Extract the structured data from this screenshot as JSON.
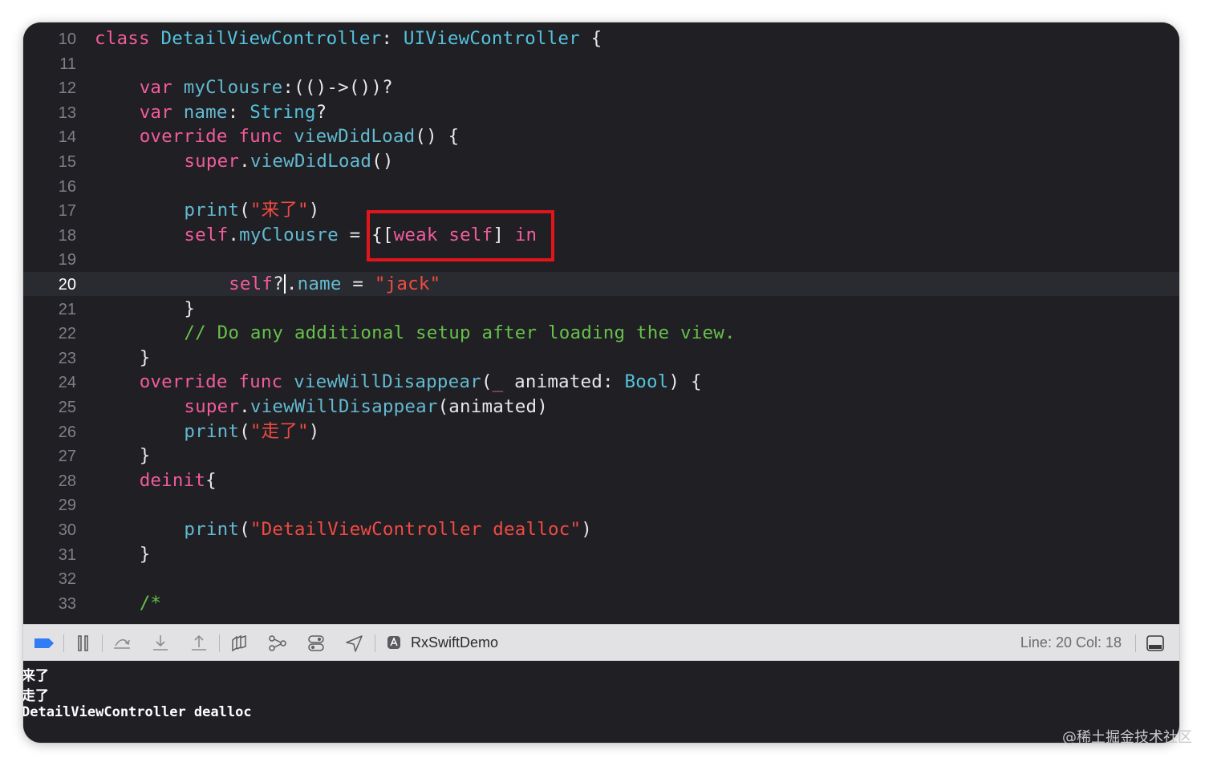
{
  "editor": {
    "current_line": 20,
    "lines": [
      {
        "n": "10",
        "indent": 0,
        "tokens": [
          [
            "kw",
            "class "
          ],
          [
            "ty",
            "DetailViewController"
          ],
          [
            "pl",
            ": "
          ],
          [
            "ty",
            "UIViewController"
          ],
          [
            "pl",
            " {"
          ]
        ]
      },
      {
        "n": "11",
        "indent": 0,
        "tokens": []
      },
      {
        "n": "12",
        "indent": 1,
        "tokens": [
          [
            "kw",
            "var "
          ],
          [
            "fn",
            "myClousre"
          ],
          [
            "pl",
            ":(()->())?"
          ]
        ]
      },
      {
        "n": "13",
        "indent": 1,
        "tokens": [
          [
            "kw",
            "var "
          ],
          [
            "fn",
            "name"
          ],
          [
            "pl",
            ": "
          ],
          [
            "ty",
            "String"
          ],
          [
            "pl",
            "?"
          ]
        ]
      },
      {
        "n": "14",
        "indent": 1,
        "tokens": [
          [
            "kw",
            "override func "
          ],
          [
            "fn",
            "viewDidLoad"
          ],
          [
            "pl",
            "() {"
          ]
        ]
      },
      {
        "n": "15",
        "indent": 2,
        "tokens": [
          [
            "kw",
            "super"
          ],
          [
            "pl",
            "."
          ],
          [
            "fn",
            "viewDidLoad"
          ],
          [
            "pl",
            "()"
          ]
        ]
      },
      {
        "n": "16",
        "indent": 0,
        "tokens": []
      },
      {
        "n": "17",
        "indent": 2,
        "tokens": [
          [
            "fn",
            "print"
          ],
          [
            "pl",
            "("
          ],
          [
            "st",
            "\"来了\""
          ],
          [
            "pl",
            ")"
          ]
        ]
      },
      {
        "n": "18",
        "indent": 2,
        "tokens": [
          [
            "kw",
            "self"
          ],
          [
            "pl",
            "."
          ],
          [
            "fn",
            "myClousre"
          ],
          [
            "pl",
            " = {["
          ],
          [
            "kw",
            "weak self"
          ],
          [
            "pl",
            "] "
          ],
          [
            "kw",
            "in"
          ]
        ]
      },
      {
        "n": "19",
        "indent": 0,
        "tokens": []
      },
      {
        "n": "20",
        "indent": 3,
        "tokens": [
          [
            "kw",
            "self"
          ],
          [
            "pl",
            "?"
          ],
          [
            "cursor",
            ""
          ],
          [
            "pl",
            "."
          ],
          [
            "fn",
            "name"
          ],
          [
            "pl",
            " = "
          ],
          [
            "st",
            "\"jack\""
          ]
        ]
      },
      {
        "n": "21",
        "indent": 2,
        "tokens": [
          [
            "pl",
            "}"
          ]
        ]
      },
      {
        "n": "22",
        "indent": 2,
        "tokens": [
          [
            "cm",
            "// Do any additional setup after loading the view."
          ]
        ]
      },
      {
        "n": "23",
        "indent": 1,
        "tokens": [
          [
            "pl",
            "}"
          ]
        ]
      },
      {
        "n": "24",
        "indent": 1,
        "tokens": [
          [
            "kw",
            "override func "
          ],
          [
            "fn",
            "viewWillDisappear"
          ],
          [
            "pl",
            "("
          ],
          [
            "kw",
            "_"
          ],
          [
            "pl",
            " animated: "
          ],
          [
            "ty",
            "Bool"
          ],
          [
            "pl",
            ") {"
          ]
        ]
      },
      {
        "n": "25",
        "indent": 2,
        "tokens": [
          [
            "kw",
            "super"
          ],
          [
            "pl",
            "."
          ],
          [
            "fn",
            "viewWillDisappear"
          ],
          [
            "pl",
            "(animated)"
          ]
        ]
      },
      {
        "n": "26",
        "indent": 2,
        "tokens": [
          [
            "fn",
            "print"
          ],
          [
            "pl",
            "("
          ],
          [
            "st",
            "\"走了\""
          ],
          [
            "pl",
            ")"
          ]
        ]
      },
      {
        "n": "27",
        "indent": 1,
        "tokens": [
          [
            "pl",
            "}"
          ]
        ]
      },
      {
        "n": "28",
        "indent": 1,
        "tokens": [
          [
            "kw",
            "deinit"
          ],
          [
            "pl",
            "{"
          ]
        ]
      },
      {
        "n": "29",
        "indent": 0,
        "tokens": []
      },
      {
        "n": "30",
        "indent": 2,
        "tokens": [
          [
            "fn",
            "print"
          ],
          [
            "pl",
            "("
          ],
          [
            "st",
            "\"DetailViewController dealloc\""
          ],
          [
            "pl",
            ")"
          ]
        ]
      },
      {
        "n": "31",
        "indent": 1,
        "tokens": [
          [
            "pl",
            "}"
          ]
        ]
      },
      {
        "n": "32",
        "indent": 0,
        "tokens": []
      },
      {
        "n": "33",
        "indent": 1,
        "tokens": [
          [
            "cm",
            "/*"
          ]
        ]
      }
    ]
  },
  "debug_bar": {
    "breakpoint_toggle_color": "#2f7cf6",
    "icons": [
      "breakpoints-toggle-icon",
      "pause-icon",
      "step-over-icon",
      "step-into-icon",
      "step-out-icon",
      "view-hierarchy-icon",
      "memory-graph-icon",
      "environment-overrides-icon",
      "simulate-location-icon"
    ],
    "target_label": "RxSwiftDemo",
    "status": "Line: 20  Col: 18"
  },
  "console": {
    "lines": [
      "来了",
      "走了",
      "DetailViewController dealloc"
    ]
  },
  "watermark": "@稀土掘金技术社区"
}
